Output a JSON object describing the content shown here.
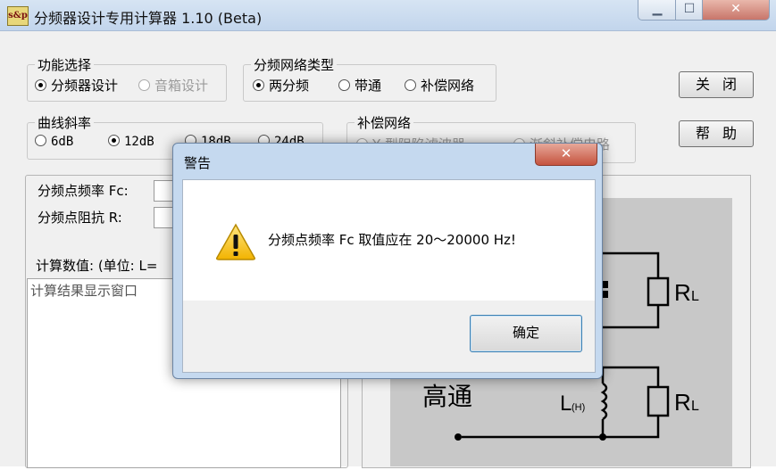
{
  "main": {
    "title": "分频器设计专用计算器 1.10 (Beta)",
    "icon_text": "s&p",
    "function_group": {
      "legend": "功能选择",
      "options": [
        {
          "label": "分频器设计",
          "selected": true,
          "enabled": true
        },
        {
          "label": "音箱设计",
          "selected": false,
          "enabled": false
        }
      ]
    },
    "network_type_group": {
      "legend": "分频网络类型",
      "options": [
        {
          "label": "两分频",
          "selected": true
        },
        {
          "label": "带通",
          "selected": false
        },
        {
          "label": "补偿网络",
          "selected": false
        }
      ]
    },
    "slope_group": {
      "legend": "曲线斜率",
      "options": [
        {
          "label": "6dB",
          "selected": false
        },
        {
          "label": "12dB",
          "selected": true
        },
        {
          "label": "18dB",
          "selected": false
        },
        {
          "label": "24dB",
          "selected": false
        }
      ]
    },
    "compensation_group": {
      "legend": "补偿网络",
      "options": [
        {
          "label": "Y 型阻陷滤波器",
          "selected": false
        },
        {
          "label": "渐斜补偿电路",
          "selected": false
        }
      ]
    },
    "buttons": {
      "close": "关闭",
      "help": "帮助"
    },
    "inputs": {
      "fc_label": "分频点频率 Fc:",
      "r_label": "分频点阻抗 R:",
      "calc_label": "计算数值: (单位: L="
    },
    "result_placeholder": "计算结果显示窗口",
    "diagram": {
      "highpass_label": "高通",
      "inductor_label": "L",
      "inductor_sub": "(H)",
      "resistor_label": "R",
      "resistor_sub": "L"
    }
  },
  "dialog": {
    "title": "警告",
    "close_glyph": "✕",
    "message": "分频点频率 Fc 取值应在 20～20000 Hz!",
    "ok_label": "确定"
  }
}
